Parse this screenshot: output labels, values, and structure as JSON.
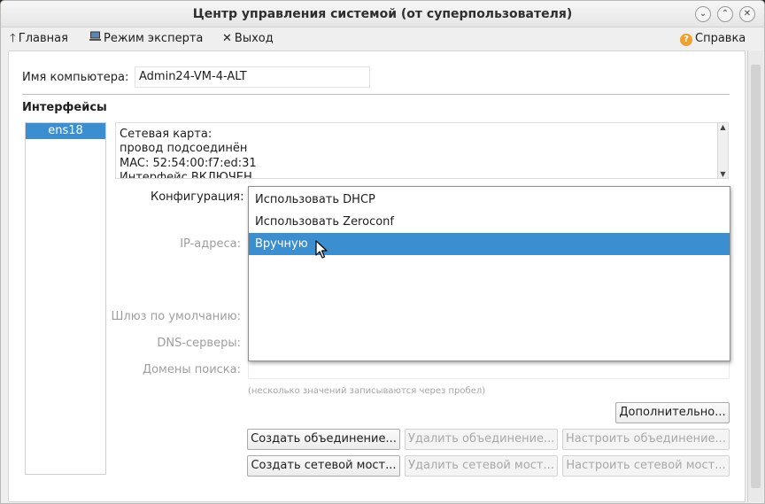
{
  "window": {
    "title": "Центр управления системой (от суперпользователя)",
    "controls": [
      "⌄",
      "⌃",
      "✕"
    ]
  },
  "toolbar": {
    "home_label": "Главная",
    "expert_label": "Режим эксперта",
    "exit_label": "Выход",
    "help_label": "Справка"
  },
  "form": {
    "computer_name_label": "Имя компьютера:",
    "computer_name_value": "Admin24-VM-4-ALT",
    "interfaces_heading": "Интерфейсы",
    "interfaces": [
      "ens18"
    ],
    "info_lines": [
      "Сетевая карта:",
      "провод подсоединён",
      "MAC: 52:54:00:f7:ed:31",
      "Интерфейс ВКЛЮЧЕН"
    ],
    "config_label": "Конфигурация:",
    "ip_label": "IP-адреса:",
    "gateway_label": "Шлюз по умолчанию:",
    "dns_label": "DNS-серверы:",
    "search_label": "Домены поиска:",
    "search_hint": "(несколько значений записываются через пробел)"
  },
  "dropdown": {
    "options": [
      "Использовать DHCP",
      "Использовать Zeroconf",
      "Вручную"
    ],
    "highlighted": "Вручную"
  },
  "buttons": {
    "advanced": "Дополнительно...",
    "create_bond": "Создать объединение...",
    "delete_bond": "Удалить объединение...",
    "configure_bond": "Настроить объединение...",
    "create_bridge": "Создать сетевой мост...",
    "delete_bridge": "Удалить сетевой мост...",
    "configure_bridge": "Настроить сетевой мост..."
  },
  "colors": {
    "selection": "#3b8ed0",
    "help_icon": "#f0a030"
  }
}
